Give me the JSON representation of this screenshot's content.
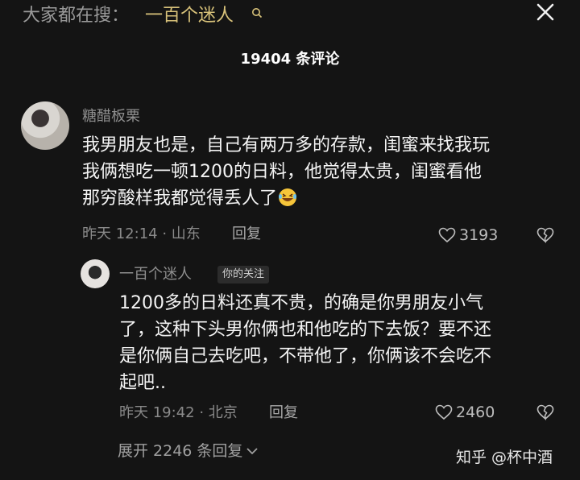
{
  "search": {
    "prefix": "大家都在搜：",
    "query": "一百个迷人",
    "query_color": "#d8c27a"
  },
  "header": {
    "comment_count": "19404 条评论"
  },
  "comments": [
    {
      "username": "糖醋板栗",
      "lines": [
        "我男朋友也是，自己有两万多的存款，闺蜜来找我玩",
        "我俩想吃一顿1200的日料，他觉得太贵，闺蜜看他",
        "那穷酸样我都觉得丢人了"
      ],
      "emoji": "laughing-crying-emoji",
      "meta": "昨天 12:14 · 山东",
      "reply_label": "回复",
      "likes": "3193"
    },
    {
      "username": "一百个迷人",
      "badge": "你的关注",
      "lines": [
        "1200多的日料还真不贵，的确是你男朋友小气",
        "了，这种下头男你俩也和他吃的下去饭？要不还",
        "是你俩自己去吃吧，不带他了，你俩该不会吃不",
        "起吧.."
      ],
      "meta": "昨天 19:42 · 北京",
      "reply_label": "回复",
      "likes": "2460"
    }
  ],
  "footer": {
    "expand_label": "展开 2246 条回复",
    "watermark": "知乎 @杯中酒"
  }
}
